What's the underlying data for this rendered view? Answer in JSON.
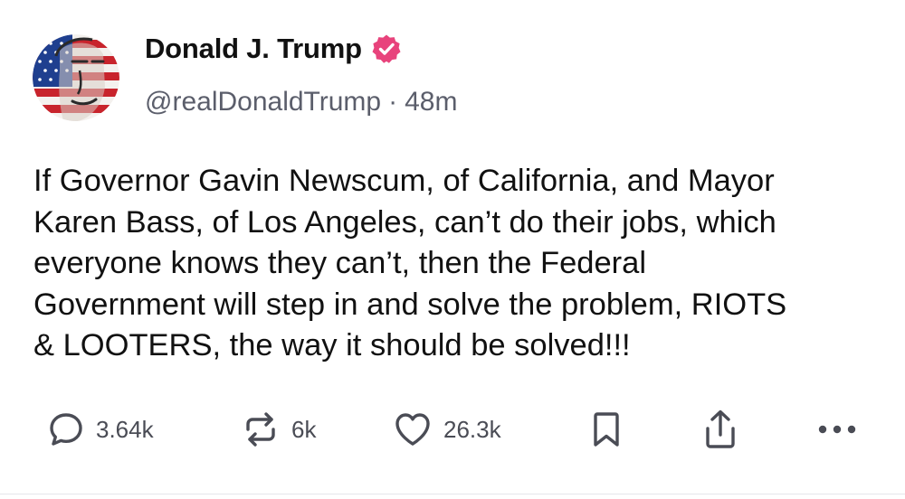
{
  "author": {
    "display_name": "Donald J. Trump",
    "handle": "@realDonaldTrump",
    "separator": "·",
    "time_ago": "48m",
    "verified": true,
    "verified_badge_color": "#e8437c",
    "avatar_icon": "profile-avatar-flag-portrait"
  },
  "post": {
    "text": "If Governor Gavin Newscum, of California, and Mayor\nKaren Bass, of Los Angeles, can’t do their jobs, which\neveryone knows they can’t, then the Federal\nGovernment will step in and solve the problem, RIOTS\n& LOOTERS, the way it should be solved!!!"
  },
  "actions": {
    "replies": {
      "icon": "reply-bubble-icon",
      "count": "3.64k"
    },
    "reposts": {
      "icon": "repost-icon",
      "count": "6k"
    },
    "likes": {
      "icon": "heart-icon",
      "count": "26.3k"
    },
    "bookmark": {
      "icon": "bookmark-icon"
    },
    "share": {
      "icon": "share-icon"
    },
    "more": {
      "icon": "more-dots-icon"
    },
    "icon_color": "#4a4c55"
  }
}
